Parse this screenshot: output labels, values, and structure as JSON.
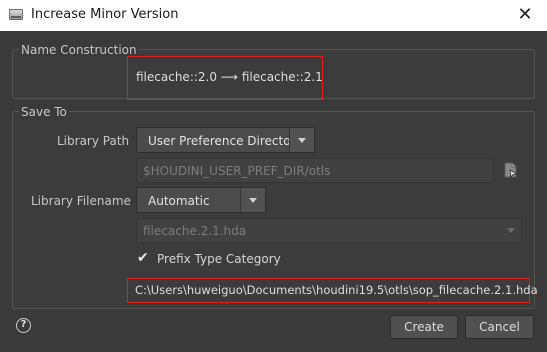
{
  "window": {
    "title": "Increase Minor Version",
    "close_glyph": "✕"
  },
  "name_construction": {
    "group_label": "Name Construction",
    "text": "filecache::2.0 ⟶ filecache::2.1"
  },
  "save_to": {
    "group_label": "Save To",
    "library_path_label": "Library Path",
    "library_path_value": "User Preference Directory",
    "library_dir_value": "$HOUDINI_USER_PREF_DIR/otls",
    "library_filename_label": "Library Filename",
    "library_filename_mode": "Automatic",
    "library_filename_value": "filecache.2.1.hda",
    "prefix_checkbox_label": "Prefix Type Category",
    "prefix_checked": true,
    "full_path": "C:\\Users\\huweiguo\\Documents\\houdini19.5\\otls\\sop_filecache.2.1.hda"
  },
  "buttons": {
    "create": "Create",
    "cancel": "Cancel",
    "help": "?"
  },
  "icons": {
    "app": "houdini-dialog-icon",
    "close": "close-icon",
    "browse": "file-browse-icon",
    "dropdown": "chevron-down-icon",
    "check": "checkmark-icon",
    "help": "help-icon"
  },
  "colors": {
    "highlight_box": "#e02020",
    "background": "#3a3a3a"
  }
}
